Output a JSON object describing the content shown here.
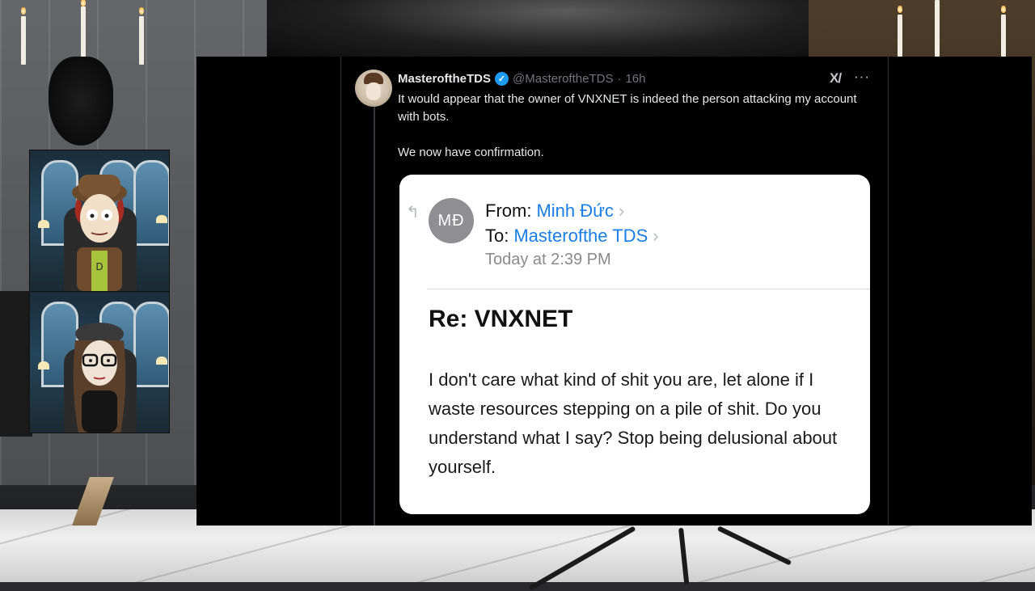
{
  "tweet": {
    "display_name": "MasteroftheTDS",
    "handle": "@MasteroftheTDS",
    "separator": "·",
    "time": "16h",
    "text_line_1": "It would appear that the owner of VNXNET is indeed the person attacking my account with bots.",
    "text_line_2": "We now have confirmation."
  },
  "email": {
    "initials": "MĐ",
    "from_label": "From:",
    "from_value": "Minh Đức",
    "to_label": "To:",
    "to_value": "Masterofthe TDS",
    "date": "Today at 2:39 PM",
    "subject": "Re: VNXNET",
    "body": "I don't care what kind of shit you are, let alone if I waste resources stepping on a pile of shit. Do you understand what I say? Stop being delusional about yourself."
  },
  "icons": [
    "verified-badge-icon",
    "grok-icon",
    "more-icon",
    "reply-arrow-icon",
    "chevron-right-icon"
  ],
  "colors": {
    "accent_blue": "#1d9bf0",
    "email_link": "#1a7ee8",
    "tweet_text": "#e7e9ea",
    "muted": "#71767b"
  }
}
